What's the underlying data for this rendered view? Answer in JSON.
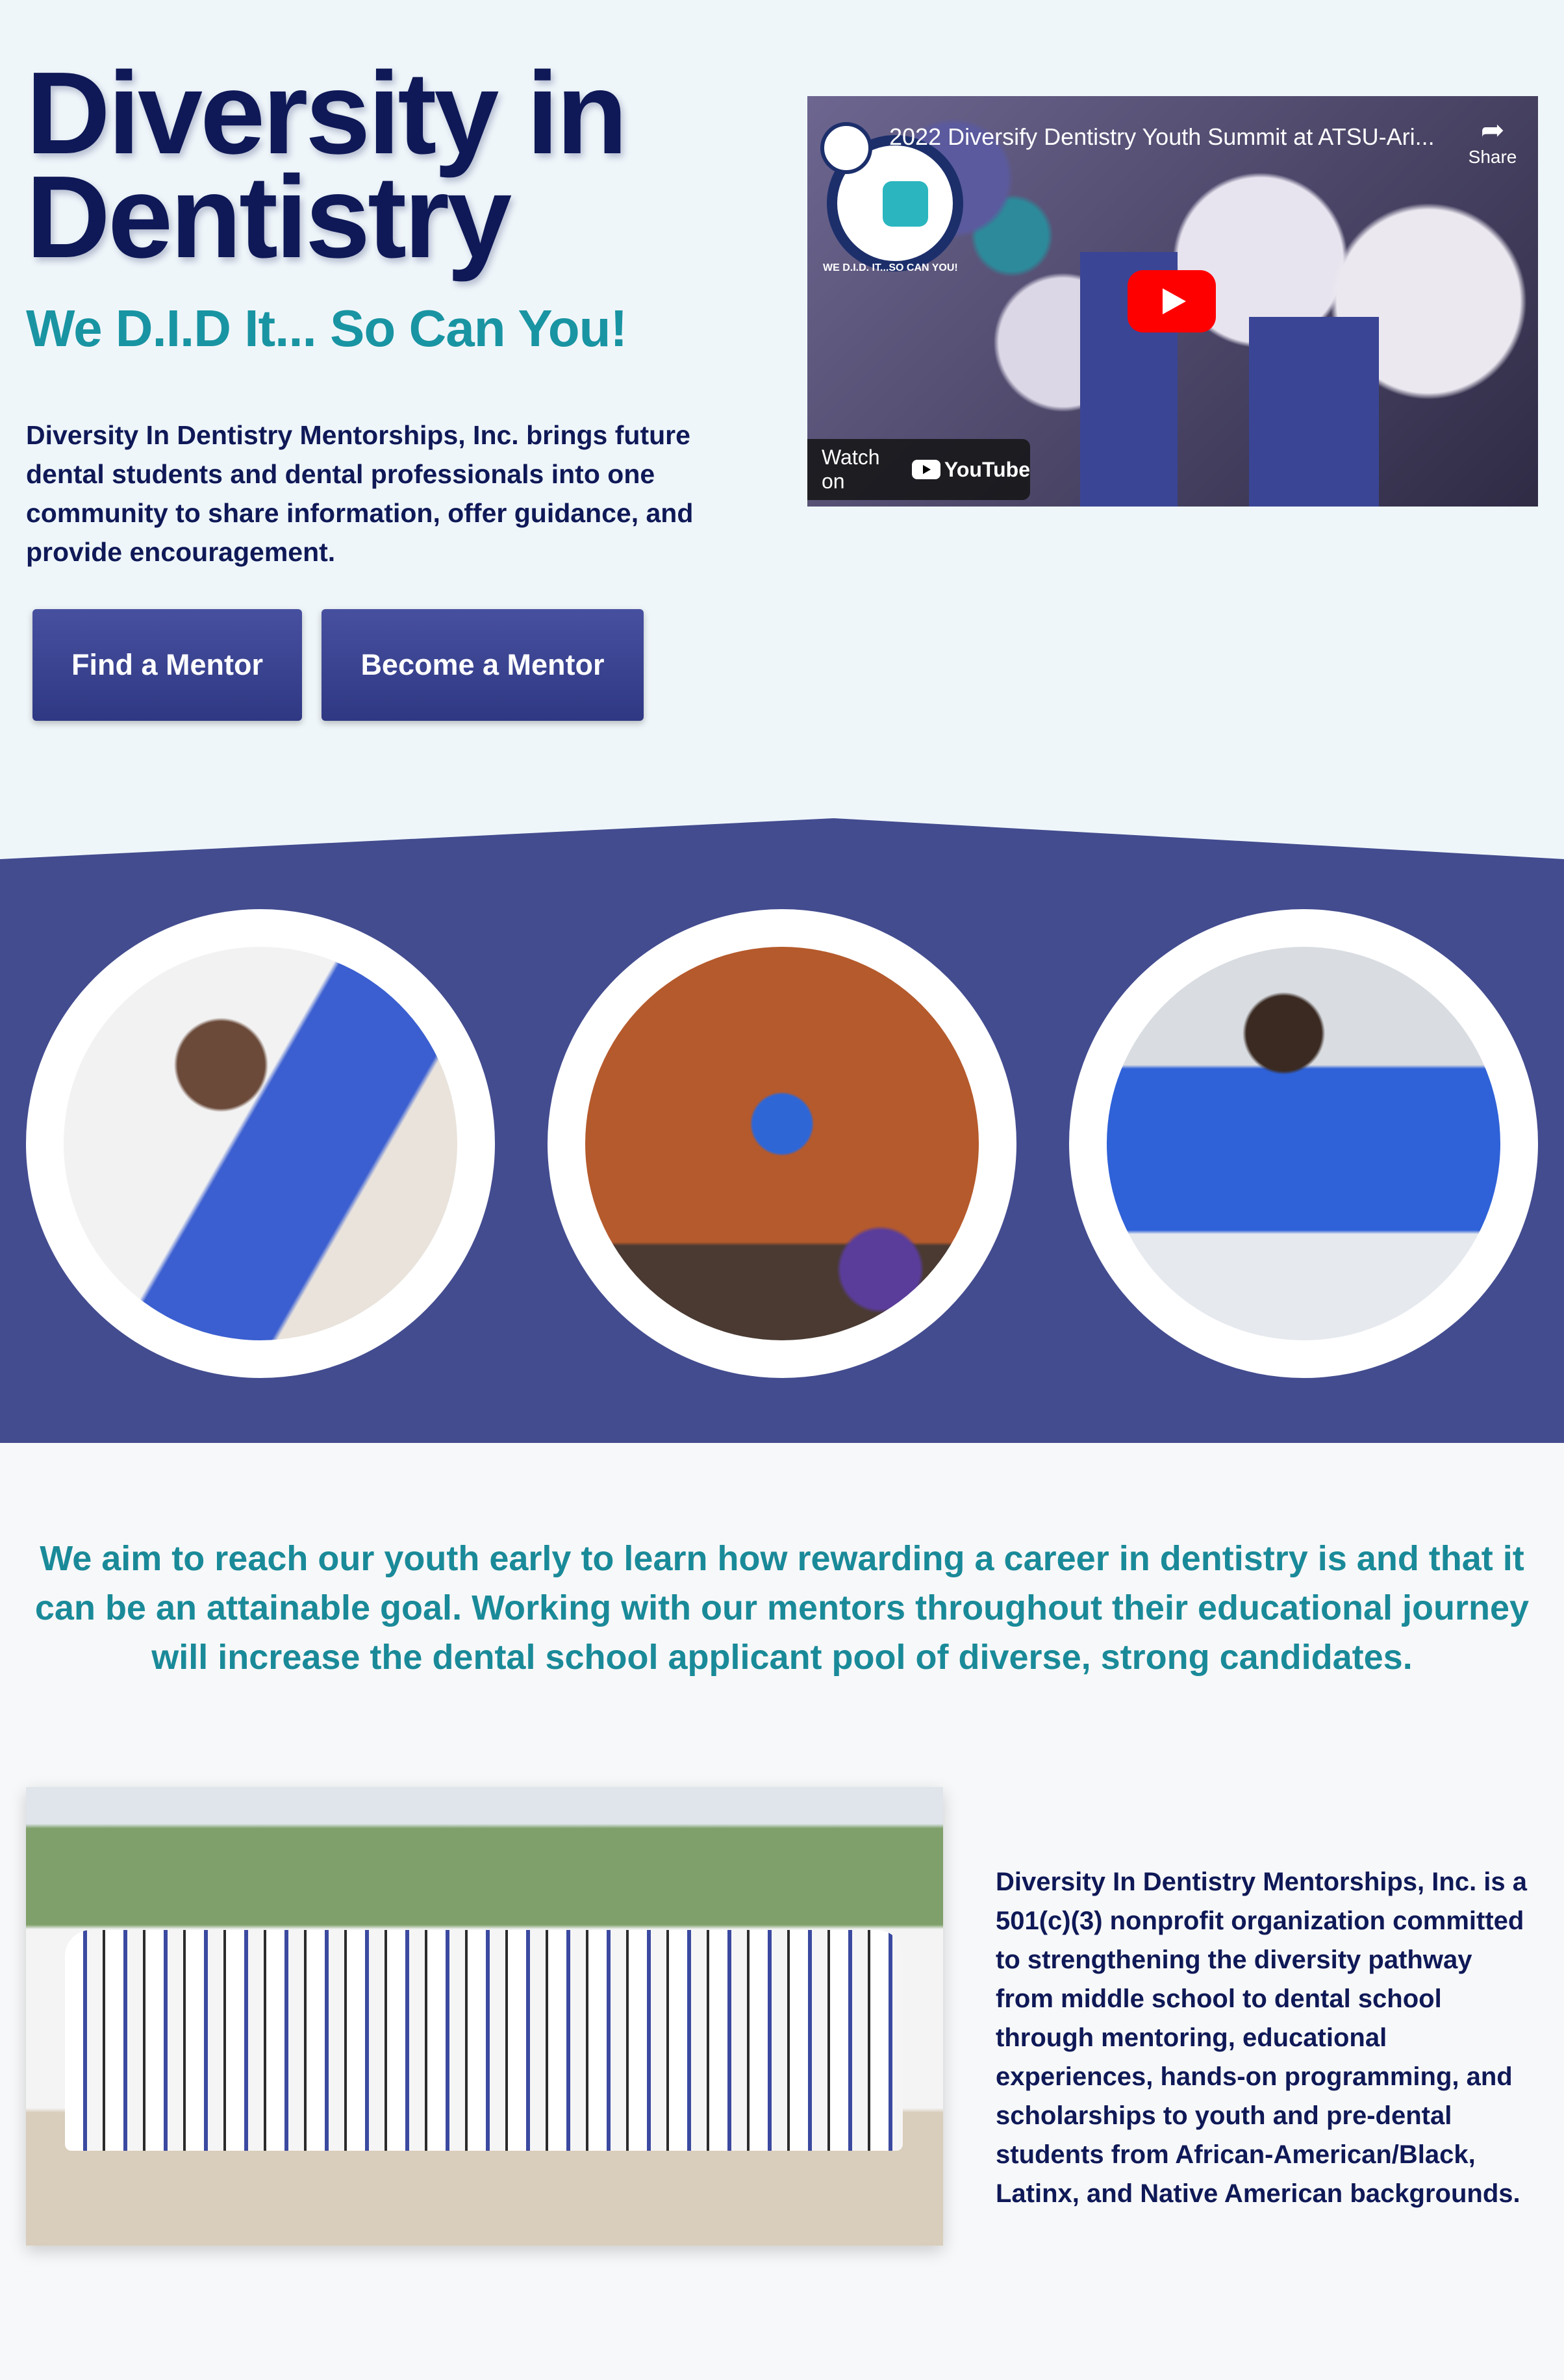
{
  "hero": {
    "title": "Diversity in Dentistry",
    "tagline": "We D.I.D It... So Can You!",
    "intro": "Diversity In Dentistry Mentorships, Inc. brings future dental students and dental professionals into one community to share information, offer guidance, and provide encouragement.",
    "buttons": {
      "find_mentor": "Find a Mentor",
      "become_mentor": "Become a Mentor"
    }
  },
  "video": {
    "title": "2022 Diversify Dentistry Youth Summit at ATSU-Ari...",
    "share_label": "Share",
    "watch_on": "Watch on",
    "youtube": "YouTube",
    "badge_text": "WE D.I.D. IT...SO CAN YOU!",
    "icons": {
      "share": "share-arrow-icon",
      "play": "play-icon",
      "logo": "channel-logo-icon"
    }
  },
  "colors": {
    "navy": "#0f1957",
    "teal": "#1994a2",
    "band": "#434c8f",
    "button": "#3a4390",
    "background": "#eff6fa"
  },
  "gallery": {
    "photos": [
      "mentor-with-student",
      "student-in-white-coat",
      "student-at-lab-bench"
    ]
  },
  "mission": {
    "text": "We aim to reach our youth early to learn how rewarding a career in dentistry is and that it can be an attainable goal. Working with our mentors throughout their educational journey will increase the dental school applicant pool of diverse, strong candidates."
  },
  "about": {
    "text": "Diversity In Dentistry Mentorships, Inc. is a 501(c)(3) nonprofit organization committed to strengthening the diversity pathway from middle school to dental school through mentoring, educational experiences, hands-on programming, and scholarships to youth and pre-dental students from African-American/Black, Latinx, and Native American backgrounds."
  }
}
